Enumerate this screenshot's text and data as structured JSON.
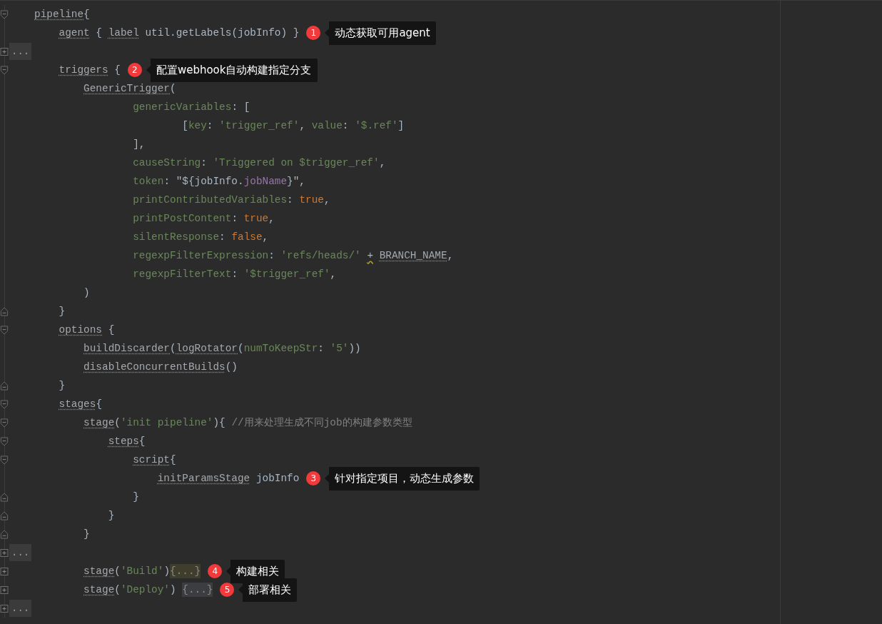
{
  "lines": [
    {
      "kind": "fold-start",
      "tokens": [
        {
          "kind": "ref",
          "text": "pipeline"
        },
        {
          "kind": "plain",
          "text": "{"
        }
      ]
    },
    {
      "kind": "plain",
      "tokens": [
        {
          "kind": "ref",
          "text": "    agent"
        },
        {
          "kind": "plain",
          "text": " { "
        },
        {
          "kind": "ref",
          "text": "label"
        },
        {
          "kind": "plain",
          "text": " util.getLabels(jobInfo) }"
        }
      ],
      "note": {
        "number": "1",
        "text": "动态获取可用agent"
      }
    },
    {
      "kind": "collapsed",
      "gutter_text": "..."
    },
    {
      "kind": "fold-start",
      "tokens": [
        {
          "kind": "ref",
          "text": "    triggers"
        },
        {
          "kind": "plain",
          "text": " {"
        }
      ],
      "note": {
        "number": "2",
        "text": "配置webhook自动构建指定分支"
      }
    },
    {
      "kind": "plain",
      "tokens": [
        {
          "kind": "ref",
          "text": "        GenericTrigger"
        },
        {
          "kind": "plain",
          "text": "("
        }
      ]
    },
    {
      "kind": "plain",
      "tokens": [
        {
          "kind": "param",
          "text": "                genericVariables"
        },
        {
          "kind": "plain",
          "text": ": ["
        }
      ]
    },
    {
      "kind": "plain",
      "tokens": [
        {
          "kind": "plain",
          "text": "                        ["
        },
        {
          "kind": "param",
          "text": "key"
        },
        {
          "kind": "plain",
          "text": ": "
        },
        {
          "kind": "string",
          "text": "'trigger_ref'"
        },
        {
          "kind": "plain",
          "text": ", "
        },
        {
          "kind": "param",
          "text": "value"
        },
        {
          "kind": "plain",
          "text": ": "
        },
        {
          "kind": "string",
          "text": "'$.ref'"
        },
        {
          "kind": "plain",
          "text": "]"
        }
      ]
    },
    {
      "kind": "plain",
      "tokens": [
        {
          "kind": "plain",
          "text": "                ],"
        }
      ]
    },
    {
      "kind": "plain",
      "tokens": [
        {
          "kind": "param",
          "text": "                causeString"
        },
        {
          "kind": "plain",
          "text": ": "
        },
        {
          "kind": "string",
          "text": "'Triggered on $trigger_ref'"
        },
        {
          "kind": "plain",
          "text": ","
        }
      ]
    },
    {
      "kind": "plain",
      "tokens": [
        {
          "kind": "param",
          "text": "                token"
        },
        {
          "kind": "plain",
          "text": ": \"${jobInfo."
        },
        {
          "kind": "field",
          "text": "jobName"
        },
        {
          "kind": "plain",
          "text": "}\","
        }
      ]
    },
    {
      "kind": "plain",
      "tokens": [
        {
          "kind": "param",
          "text": "                printContributedVariables"
        },
        {
          "kind": "plain",
          "text": ": "
        },
        {
          "kind": "bool",
          "text": "true"
        },
        {
          "kind": "plain",
          "text": ","
        }
      ]
    },
    {
      "kind": "plain",
      "tokens": [
        {
          "kind": "param",
          "text": "                printPostContent"
        },
        {
          "kind": "plain",
          "text": ": "
        },
        {
          "kind": "bool",
          "text": "true"
        },
        {
          "kind": "plain",
          "text": ","
        }
      ]
    },
    {
      "kind": "plain",
      "tokens": [
        {
          "kind": "param",
          "text": "                silentResponse"
        },
        {
          "kind": "plain",
          "text": ": "
        },
        {
          "kind": "bool",
          "text": "false"
        },
        {
          "kind": "plain",
          "text": ","
        }
      ]
    },
    {
      "kind": "plain",
      "tokens": [
        {
          "kind": "param",
          "text": "                regexpFilterExpression"
        },
        {
          "kind": "plain",
          "text": ": "
        },
        {
          "kind": "string",
          "text": "'refs/heads/' "
        },
        {
          "kind": "warn",
          "text": "+"
        },
        {
          "kind": "ref",
          "text": "BRANCH_NAME"
        },
        {
          "kind": "plain",
          "text": ","
        }
      ]
    },
    {
      "kind": "plain",
      "tokens": [
        {
          "kind": "param",
          "text": "                regexpFilterText"
        },
        {
          "kind": "plain",
          "text": ": "
        },
        {
          "kind": "string",
          "text": "'$trigger_ref'"
        },
        {
          "kind": "plain",
          "text": ","
        }
      ]
    },
    {
      "kind": "plain",
      "tokens": [
        {
          "kind": "plain",
          "text": "        )"
        }
      ]
    },
    {
      "kind": "fold-end",
      "tokens": [
        {
          "kind": "plain",
          "text": "    }"
        }
      ]
    },
    {
      "kind": "fold-start",
      "tokens": [
        {
          "kind": "ref",
          "text": "    options"
        },
        {
          "kind": "plain",
          "text": " {"
        }
      ]
    },
    {
      "kind": "plain",
      "tokens": [
        {
          "kind": "ref",
          "text": "        buildDiscarder"
        },
        {
          "kind": "plain",
          "text": "("
        },
        {
          "kind": "ref",
          "text": "logRotator"
        },
        {
          "kind": "plain",
          "text": "("
        },
        {
          "kind": "param",
          "text": "numToKeepStr"
        },
        {
          "kind": "plain",
          "text": ": "
        },
        {
          "kind": "string",
          "text": "'5'"
        },
        {
          "kind": "plain",
          "text": "))"
        }
      ]
    },
    {
      "kind": "plain",
      "tokens": [
        {
          "kind": "ref",
          "text": "        disableConcurrentBuilds"
        },
        {
          "kind": "plain",
          "text": "()"
        }
      ]
    },
    {
      "kind": "fold-end",
      "tokens": [
        {
          "kind": "plain",
          "text": "    }"
        }
      ]
    },
    {
      "kind": "fold-start",
      "tokens": [
        {
          "kind": "ref",
          "text": "    stages"
        },
        {
          "kind": "plain",
          "text": "{"
        }
      ]
    },
    {
      "kind": "fold-start",
      "tokens": [
        {
          "kind": "ref",
          "text": "        stage"
        },
        {
          "kind": "plain",
          "text": "("
        },
        {
          "kind": "string",
          "text": "'init pipeline'"
        },
        {
          "kind": "plain",
          "text": "){ "
        },
        {
          "kind": "comment",
          "text": "//用来处理生成不同job的构建参数类型"
        }
      ]
    },
    {
      "kind": "fold-start",
      "tokens": [
        {
          "kind": "ref",
          "text": "            steps"
        },
        {
          "kind": "plain",
          "text": "{"
        }
      ]
    },
    {
      "kind": "fold-start",
      "tokens": [
        {
          "kind": "ref",
          "text": "                script"
        },
        {
          "kind": "plain",
          "text": "{"
        }
      ]
    },
    {
      "kind": "plain",
      "tokens": [
        {
          "kind": "ref",
          "text": "                    initParamsStage"
        },
        {
          "kind": "plain",
          "text": " jobInfo"
        }
      ],
      "note": {
        "number": "3",
        "text": "针对指定项目，动态生成参数"
      }
    },
    {
      "kind": "fold-end",
      "tokens": [
        {
          "kind": "plain",
          "text": "                }"
        }
      ]
    },
    {
      "kind": "fold-end",
      "tokens": [
        {
          "kind": "plain",
          "text": "            }"
        }
      ]
    },
    {
      "kind": "fold-end",
      "tokens": [
        {
          "kind": "plain",
          "text": "        }"
        }
      ]
    },
    {
      "kind": "collapsed",
      "gutter_text": "..."
    },
    {
      "kind": "collapsed",
      "tokens": [
        {
          "kind": "ref",
          "text": "        stage"
        },
        {
          "kind": "plain",
          "text": "("
        },
        {
          "kind": "string",
          "text": "'Build'"
        },
        {
          "kind": "plain",
          "text": ")"
        },
        {
          "kind": "folded-active",
          "text": "{...}"
        }
      ],
      "note": {
        "number": "4",
        "text": "构建相关"
      }
    },
    {
      "kind": "collapsed",
      "tokens": [
        {
          "kind": "ref",
          "text": "        stage"
        },
        {
          "kind": "plain",
          "text": "("
        },
        {
          "kind": "string",
          "text": "'Deploy'"
        },
        {
          "kind": "plain",
          "text": ") "
        },
        {
          "kind": "folded",
          "text": "{...}"
        }
      ],
      "note": {
        "number": "5",
        "text": "部署相关"
      }
    },
    {
      "kind": "collapsed",
      "gutter_text": "..."
    }
  ]
}
